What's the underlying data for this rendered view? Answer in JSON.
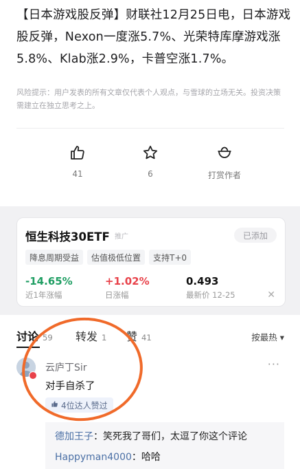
{
  "article": {
    "body": "【日本游戏股反弹】财联社12月25日电，日本游戏股反弹，Nexon一度涨5.7%、光荣特库摩游戏涨5.8%、Klab涨2.9%，卡普空涨1.7%。",
    "disclaimer": "风险提示：用户发表的所有文章仅代表个人观点，与雪球的立场无关。投资决策需建立在独立思考之上。"
  },
  "actions": {
    "like_count": "41",
    "favorite_count": "6",
    "reward_label": "打赏作者"
  },
  "etf_card": {
    "name": "恒生科技30ETF",
    "ad_tag": "推广",
    "added_label": "已添加",
    "tags": [
      "降息周期受益",
      "估值极低位置",
      "支持T+0"
    ],
    "metrics": [
      {
        "value": "-14.65%",
        "label": "近1年涨幅"
      },
      {
        "value": "+1.02%",
        "label": "日涨幅"
      },
      {
        "value": "0.493",
        "label": "最新价 12-25"
      }
    ],
    "colors": {
      "negative": "#1f9e63",
      "positive": "#e8424a"
    }
  },
  "discussion": {
    "tabs": [
      {
        "label": "讨论",
        "count": "59"
      },
      {
        "label": "转发",
        "count": "1"
      },
      {
        "label": "赞",
        "count": "41"
      }
    ],
    "sort_label": "按最热 ▾",
    "comment": {
      "user": "云庐丁Sir",
      "text": "对手自杀了",
      "liked_by": "4位达人赞过",
      "more": "···"
    },
    "replies": [
      {
        "user": "德加王子",
        "text": "：笑死我了哥们，太逗了你这个评论"
      },
      {
        "user": "Happyman4000",
        "text": "：哈哈"
      }
    ]
  }
}
